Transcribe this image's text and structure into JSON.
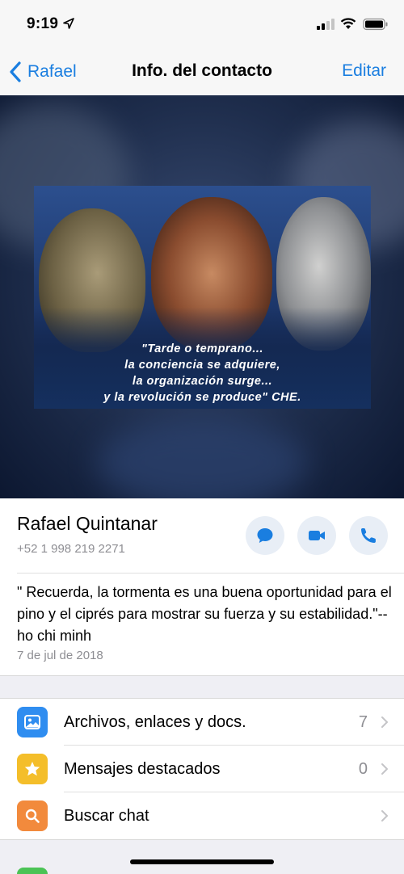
{
  "status_bar": {
    "time": "9:19"
  },
  "nav": {
    "back_label": "Rafael",
    "title": "Info. del contacto",
    "edit_label": "Editar"
  },
  "photo": {
    "caption_lines": [
      "\"Tarde o temprano...",
      "la conciencia se adquiere,",
      "la organización surge...",
      "y la revolución se produce\" CHE."
    ]
  },
  "contact": {
    "name": "Rafael Quintanar",
    "phone": "+52 1 998 219 2271",
    "about": "\" Recuerda, la tormenta es una buena oportunidad para el pino y el ciprés para mostrar su fuerza y su estabilidad.\"-- ho chi minh",
    "about_date": "7 de jul de 2018"
  },
  "actions": [
    {
      "icon": "chat-bubble-icon"
    },
    {
      "icon": "video-camera-icon"
    },
    {
      "icon": "phone-icon"
    }
  ],
  "menu": [
    {
      "label": "Archivos, enlaces y docs.",
      "count": "7",
      "icon": "photo-icon",
      "color": "#2f8df0"
    },
    {
      "label": "Mensajes destacados",
      "count": "0",
      "icon": "star-icon",
      "color": "#f4be2a"
    },
    {
      "label": "Buscar chat",
      "count": "",
      "icon": "search-icon",
      "color": "#f28a3c"
    }
  ],
  "colors": {
    "accent": "#1a7ee0",
    "action_bg": "#e8eef6"
  }
}
